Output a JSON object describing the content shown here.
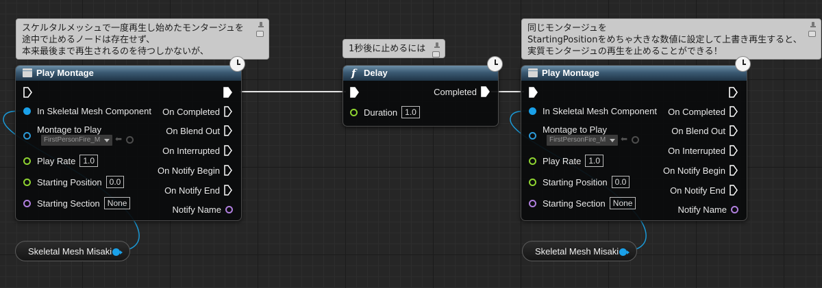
{
  "comments": [
    {
      "lines": [
        "スケルタルメッシュで一度再生し始めたモンタージュを",
        "途中で止めるノードは存在せず、",
        "本来最後まで再生されるのを待つしかないが、"
      ]
    },
    {
      "lines": [
        "1秒後に止めるには"
      ]
    },
    {
      "lines": [
        "同じモンタージュを",
        "StartingPositionをめちゃ大きな数値に設定して上書き再生すると、",
        "実質モンタージュの再生を止めることができる！"
      ]
    }
  ],
  "play_montage_1": {
    "title": "Play Montage",
    "inputs": {
      "in_skeletal_mesh_component": "In Skeletal Mesh Component",
      "montage_to_play": "Montage to Play",
      "montage_value": "FirstPersonFire_M",
      "play_rate": "Play Rate",
      "play_rate_value": "1.0",
      "starting_position": "Starting Position",
      "starting_position_value": "0.0",
      "starting_section": "Starting Section",
      "starting_section_value": "None"
    },
    "outputs": {
      "on_completed": "On Completed",
      "on_blend_out": "On Blend Out",
      "on_interrupted": "On Interrupted",
      "on_notify_begin": "On Notify Begin",
      "on_notify_end": "On Notify End",
      "notify_name": "Notify Name"
    }
  },
  "delay": {
    "title": "Delay",
    "completed": "Completed",
    "duration": "Duration",
    "duration_value": "1.0"
  },
  "play_montage_2": {
    "title": "Play Montage",
    "inputs": {
      "in_skeletal_mesh_component": "In Skeletal Mesh Component",
      "montage_to_play": "Montage to Play",
      "montage_value": "FirstPersonFire_M",
      "play_rate": "Play Rate",
      "play_rate_value": "1.0",
      "starting_position": "Starting Position",
      "starting_position_value": "0.0",
      "starting_section": "Starting Section",
      "starting_section_value": "None"
    },
    "outputs": {
      "on_completed": "On Completed",
      "on_blend_out": "On Blend Out",
      "on_interrupted": "On Interrupted",
      "on_notify_begin": "On Notify Begin",
      "on_notify_end": "On Notify End",
      "notify_name": "Notify Name"
    }
  },
  "variable_nodes": [
    {
      "label": "Skeletal Mesh Misaki"
    },
    {
      "label": "Skeletal Mesh Misaki"
    }
  ],
  "colors": {
    "exec": "#ffffff",
    "object_pin": "#1aa0e8",
    "float_pin": "#8fd431",
    "name_pin": "#b07fde",
    "montage_pin": "#2c9ad8"
  }
}
